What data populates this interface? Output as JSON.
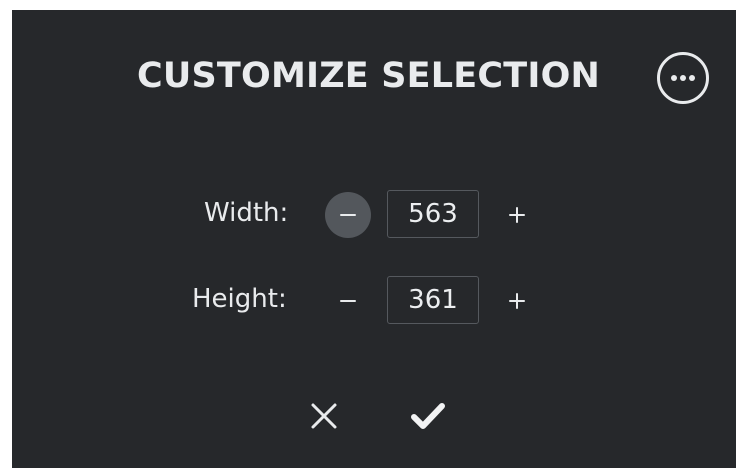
{
  "dialog": {
    "title": "CUSTOMIZE SELECTION",
    "more_icon": "more-horizontal-circle-icon"
  },
  "width": {
    "label": "Width:",
    "value": "563",
    "decrement_icon": "minus-icon",
    "increment_icon": "plus-icon"
  },
  "height": {
    "label": "Height:",
    "value": "361",
    "decrement_icon": "minus-icon",
    "increment_icon": "plus-icon"
  },
  "actions": {
    "cancel_icon": "close-icon",
    "confirm_icon": "checkmark-icon"
  },
  "colors": {
    "panel_background": "#26282b",
    "foreground": "#e9ebed",
    "active_stepper": "#53575c",
    "input_border": "#55595e"
  }
}
